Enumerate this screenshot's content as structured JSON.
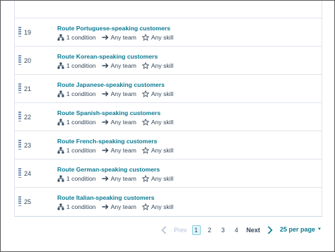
{
  "rows": [
    {
      "num": "19",
      "title": "Route Portuguese-speaking customers",
      "condition": "1 condition",
      "team": "Any team",
      "skill": "Any skill"
    },
    {
      "num": "20",
      "title": "Route Korean-speaking customers",
      "condition": "1 condition",
      "team": "Any team",
      "skill": "Any skill"
    },
    {
      "num": "21",
      "title": "Route Japanese-speaking customers",
      "condition": "1 condition",
      "team": "Any team",
      "skill": "Any skill"
    },
    {
      "num": "22",
      "title": "Route Spanish-speaking customers",
      "condition": "1 condition",
      "team": "Any team",
      "skill": "Any skill"
    },
    {
      "num": "23",
      "title": "Route French-speaking customers",
      "condition": "1 condition",
      "team": "Any team",
      "skill": "Any skill"
    },
    {
      "num": "24",
      "title": "Route German-speaking customers",
      "condition": "1 condition",
      "team": "Any team",
      "skill": "Any skill"
    },
    {
      "num": "25",
      "title": "Route Italian-speaking customers",
      "condition": "1 condition",
      "team": "Any team",
      "skill": "Any skill"
    }
  ],
  "pagination": {
    "prev_label": "Prev",
    "pages": [
      "1",
      "2",
      "3",
      "4"
    ],
    "current_page": "1",
    "next_label": "Next",
    "per_page_label": "25 per page"
  },
  "colors": {
    "link": "#0b7a92",
    "text": "#33475b",
    "border": "#dfe3eb",
    "active_page_bg": "#e5f5f8"
  }
}
